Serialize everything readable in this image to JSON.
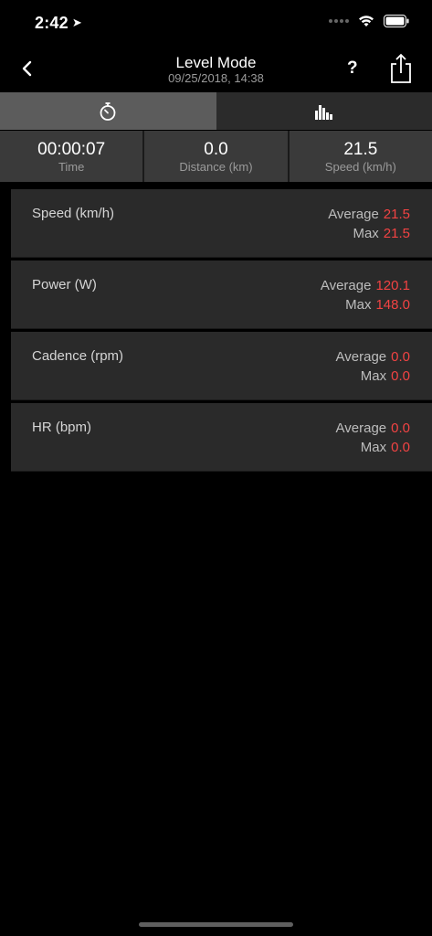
{
  "status_bar": {
    "time": "2:42"
  },
  "nav": {
    "title": "Level Mode",
    "subtitle": "09/25/2018, 14:38",
    "help_label": "?"
  },
  "tabs": [
    {
      "icon": "stopwatch-icon",
      "active": true
    },
    {
      "icon": "bar-chart-icon",
      "active": false
    }
  ],
  "summary": [
    {
      "value": "00:00:07",
      "label": "Time"
    },
    {
      "value": "0.0",
      "label": "Distance (km)"
    },
    {
      "value": "21.5",
      "label": "Speed (km/h)"
    }
  ],
  "metrics": [
    {
      "title": "Speed (km/h)",
      "avg_label": "Average",
      "avg": "21.5",
      "max_label": "Max",
      "max": "21.5"
    },
    {
      "title": "Power (W)",
      "avg_label": "Average",
      "avg": "120.1",
      "max_label": "Max",
      "max": "148.0"
    },
    {
      "title": "Cadence (rpm)",
      "avg_label": "Average",
      "avg": "0.0",
      "max_label": "Max",
      "max": "0.0"
    },
    {
      "title": "HR (bpm)",
      "avg_label": "Average",
      "avg": "0.0",
      "max_label": "Max",
      "max": "0.0"
    }
  ],
  "colors": {
    "accent_red": "#f24343",
    "active_tab": "#5c5c5c",
    "card_bg": "#2a2a2a"
  }
}
